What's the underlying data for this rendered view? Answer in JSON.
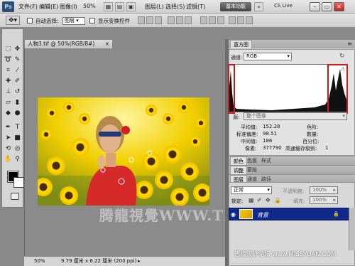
{
  "app": {
    "logo": "Ps",
    "zoom": "50%",
    "workspace": "基本功能",
    "cslive": "CS Live"
  },
  "menu": [
    "文件(F)",
    "编辑(E)",
    "图像(I)",
    "图层(L)",
    "选择(S)",
    "滤镜(T)",
    "分析(A)",
    "3D(D)",
    "视图(V)",
    "窗口(W)",
    "帮助(H)"
  ],
  "options": {
    "auto_select_label": "自动选择:",
    "auto_select_value": "图层",
    "show_transform_label": "显示变换控件"
  },
  "document": {
    "tab_title": "人物3.tif @ 50%(RGB/8#)",
    "status_zoom": "50%",
    "status_info": "9.79 厘米 x 6.22 厘米 (200 ppi)",
    "watermark": "腾龍視覺WWW.TLVI.NET"
  },
  "histogram": {
    "tab": "直方图",
    "channel_label": "通道:",
    "channel_value": "RGB",
    "source_label": "源:",
    "source_value": "整个图像",
    "stats": {
      "mean_label": "平均值:",
      "mean": "152.28",
      "std_label": "标准偏差:",
      "std": "98.51",
      "median_label": "中间值:",
      "median": "186",
      "pixels_label": "像素:",
      "pixels": "377790",
      "level_label": "色阶:",
      "level": "",
      "count_label": "数量:",
      "count": "",
      "percentile_label": "百分位:",
      "percentile": "",
      "cache_label": "高速缓存级别:",
      "cache": "1"
    }
  },
  "panels": {
    "color_tabs": [
      "颜色",
      "色板",
      "样式"
    ],
    "adjust_tabs": [
      "调整",
      "蒙版"
    ],
    "layers_tabs": [
      "图层",
      "通道",
      "路径"
    ],
    "blend_mode": "正常",
    "opacity_label": "不透明度:",
    "opacity_value": "100%",
    "lock_label": "锁定:",
    "fill_label": "填充:",
    "fill_value": "100%"
  },
  "layer": {
    "name": "背景"
  },
  "forum_watermark": "思缘设计论坛 www.MISSYUAN.COM",
  "colors": {
    "layer_highlight": "#10288a",
    "hist_markers": "#d21a1a",
    "sunflower": "#f2cf00"
  }
}
